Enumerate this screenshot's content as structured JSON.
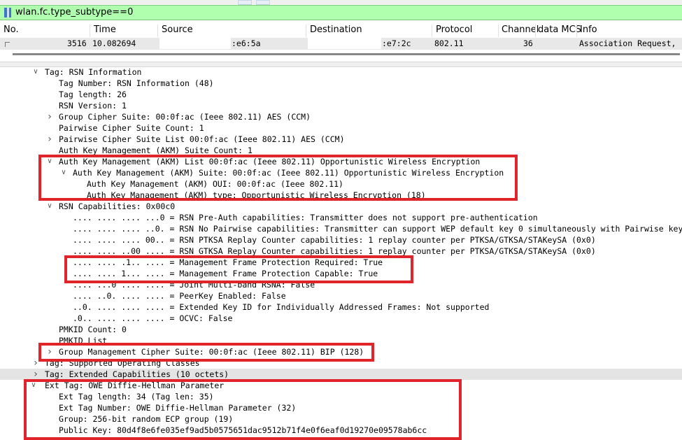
{
  "filter": {
    "text": "wlan.fc.type_subtype==0"
  },
  "columns": [
    "No.",
    "Time",
    "Source",
    "Destination",
    "Protocol",
    "Channel",
    "data MCS",
    "Info"
  ],
  "packet": {
    "no": "3516",
    "time": "10.082694",
    "source": ":e6:5a",
    "destination": ":e7:2c",
    "protocol": "802.11",
    "channel": "36",
    "info": "Association Request,"
  },
  "tree": [
    {
      "indent": 0,
      "arrow": "down",
      "text": "Tag: RSN Information"
    },
    {
      "indent": 1,
      "arrow": "",
      "text": "Tag Number: RSN Information (48)"
    },
    {
      "indent": 1,
      "arrow": "",
      "text": "Tag length: 26"
    },
    {
      "indent": 1,
      "arrow": "",
      "text": "RSN Version: 1"
    },
    {
      "indent": 1,
      "arrow": "right",
      "text": "Group Cipher Suite: 00:0f:ac (Ieee 802.11) AES (CCM)"
    },
    {
      "indent": 1,
      "arrow": "",
      "text": "Pairwise Cipher Suite Count: 1"
    },
    {
      "indent": 1,
      "arrow": "right",
      "text": "Pairwise Cipher Suite List 00:0f:ac (Ieee 802.11) AES (CCM)"
    },
    {
      "indent": 1,
      "arrow": "",
      "text": "Auth Key Management (AKM) Suite Count: 1"
    },
    {
      "indent": 1,
      "arrow": "down",
      "text": "Auth Key Management (AKM) List 00:0f:ac (Ieee 802.11) Opportunistic Wireless Encryption"
    },
    {
      "indent": 2,
      "arrow": "down",
      "text": "Auth Key Management (AKM) Suite: 00:0f:ac (Ieee 802.11) Opportunistic Wireless Encryption"
    },
    {
      "indent": 3,
      "arrow": "",
      "text": "Auth Key Management (AKM) OUI: 00:0f:ac (Ieee 802.11)"
    },
    {
      "indent": 3,
      "arrow": "",
      "text": "Auth Key Management (AKM) type: Opportunistic Wireless Encryption (18)"
    },
    {
      "indent": 1,
      "arrow": "down",
      "text": "RSN Capabilities: 0x00c0"
    },
    {
      "indent": 2.5,
      "arrow": "",
      "text": ".... .... .... ...0 = RSN Pre-Auth capabilities: Transmitter does not support pre-authentication"
    },
    {
      "indent": 2.5,
      "arrow": "",
      "text": ".... .... .... ..0. = RSN No Pairwise capabilities: Transmitter can support WEP default key 0 simultaneously with Pairwise key"
    },
    {
      "indent": 2.5,
      "arrow": "",
      "text": ".... .... .... 00.. = RSN PTKSA Replay Counter capabilities: 1 replay counter per PTKSA/GTKSA/STAKeySA (0x0)"
    },
    {
      "indent": 2.5,
      "arrow": "",
      "text": ".... .... ..00 .... = RSN GTKSA Replay Counter capabilities: 1 replay counter per PTKSA/GTKSA/STAKeySA (0x0)"
    },
    {
      "indent": 2.5,
      "arrow": "",
      "text": ".... .... .1.. .... = Management Frame Protection Required: True"
    },
    {
      "indent": 2.5,
      "arrow": "",
      "text": ".... .... 1... .... = Management Frame Protection Capable: True"
    },
    {
      "indent": 2.5,
      "arrow": "",
      "text": ".... ...0 .... .... = Joint Multi-band RSNA: False"
    },
    {
      "indent": 2.5,
      "arrow": "",
      "text": ".... ..0. .... .... = PeerKey Enabled: False"
    },
    {
      "indent": 2.5,
      "arrow": "",
      "text": "..0. .... .... .... = Extended Key ID for Individually Addressed Frames: Not supported"
    },
    {
      "indent": 2.5,
      "arrow": "",
      "text": ".0.. .... .... .... = OCVC: False"
    },
    {
      "indent": 1,
      "arrow": "",
      "text": "PMKID Count: 0"
    },
    {
      "indent": 1,
      "arrow": "",
      "text": "PMKID List"
    },
    {
      "indent": 1,
      "arrow": "right",
      "text": "Group Management Cipher Suite: 00:0f:ac (Ieee 802.11) BIP (128)"
    },
    {
      "indent": 0,
      "arrow": "right",
      "text": "Tag: Supported Operating Classes"
    },
    {
      "indent": 0,
      "arrow": "right",
      "text": "Tag: Extended Capabilities (10 octets)",
      "selected": true
    },
    {
      "indent": -1,
      "arrow": "down",
      "text": "Ext Tag: OWE Diffie-Hellman Parameter"
    },
    {
      "indent": 1,
      "arrow": "",
      "text": "Ext Tag length: 34 (Tag len: 35)"
    },
    {
      "indent": 1,
      "arrow": "",
      "text": "Ext Tag Number: OWE Diffie-Hellman Parameter (32)"
    },
    {
      "indent": 1,
      "arrow": "",
      "text": "Group: 256-bit random ECP group (19)"
    },
    {
      "indent": 1,
      "arrow": "",
      "text": "Public Key: 80d4f8e6fe035ef9ad5b0575651dac9512b71f4e0f6eaf0d19270e09578ab6cc"
    }
  ],
  "colors": {
    "filter_bg": "#afffaf",
    "highlight": "#e0242a",
    "selected_row": "#e4e4e4"
  }
}
